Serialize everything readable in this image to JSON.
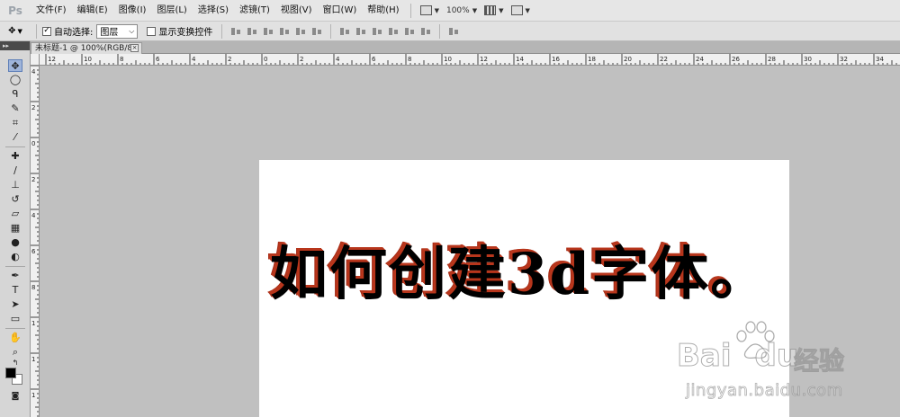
{
  "app": {
    "logo": "Ps",
    "menu": [
      "文件(F)",
      "编辑(E)",
      "图像(I)",
      "图层(L)",
      "选择(S)",
      "滤镜(T)",
      "视图(V)",
      "窗口(W)",
      "帮助(H)"
    ],
    "zoom": "100%"
  },
  "options": {
    "auto_select_label": "自动选择:",
    "auto_select_checked": "✓",
    "layer_select": "图层",
    "show_transform_label": "显示变换控件"
  },
  "document": {
    "tab_title": "未标题-1 @ 100%(RGB/8) *",
    "close_glyph": "×"
  },
  "rulers": {
    "h_labels": [
      "12",
      "10",
      "8",
      "6",
      "4",
      "2",
      "0",
      "2",
      "4",
      "6",
      "8",
      "10",
      "12",
      "14",
      "16",
      "18",
      "20",
      "22",
      "24",
      "26",
      "28",
      "30",
      "32",
      "34"
    ],
    "v_labels": [
      "4",
      "2",
      "0",
      "2",
      "4",
      "6",
      "8",
      "1",
      "1",
      "1"
    ]
  },
  "canvas": {
    "headline": "如何创建3d字体。",
    "text_color": "#000000",
    "extrusion_color": "#b8361c"
  },
  "watermark": {
    "logo": "Bai",
    "logo_suffix": "du",
    "cn": "经验",
    "url": "jingyan.baidu.com"
  }
}
